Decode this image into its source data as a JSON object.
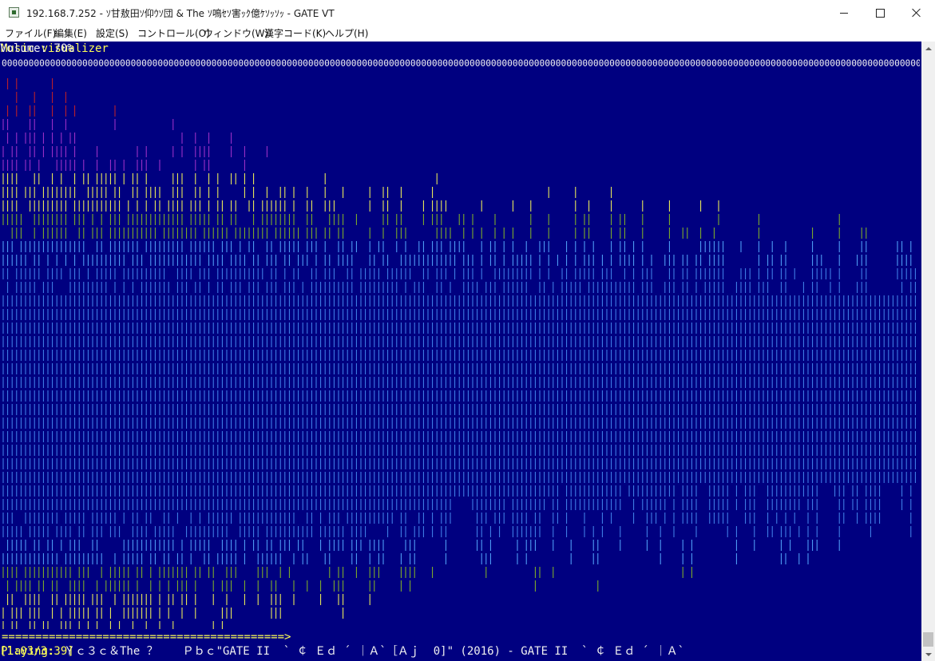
{
  "window": {
    "title": "192.168.7.252 - ｿ甘敖田ｿ仰ｳｿ団 & The ｿ鳴ｾｿ害ｯｸ億ｹｿｯｿｯ - GATE VT",
    "app_icon": "terminal-app-icon",
    "minimize_icon": "minimize-icon",
    "maximize_icon": "maximize-icon",
    "close_icon": "close-icon"
  },
  "menu": {
    "items": [
      {
        "label": "ファイル(F)"
      },
      {
        "label": "編集(E)"
      },
      {
        "label": "設定(S)"
      },
      {
        "label": "コントロール(O)"
      },
      {
        "label": "ウィンドウ(W)"
      },
      {
        "label": "漢字コード(K)"
      },
      {
        "label": "ヘルプ(H)"
      }
    ]
  },
  "terminal": {
    "title": "Music visualizer",
    "volume": "Volume: 70%",
    "zeros": "00000000000000000000000000000000000000000000000000000000000000000000000000000000000000000000000000000000000000000000000000000000000000000000000000000000000000000000000000000000000000000000000000000000000000",
    "progress": "==========================================>",
    "playing_label": "Playing:",
    "playing_title": "Ｙｃ３ｃ＆The ？￣  Ｐｂｃ\"GATE II  ` ￠ Ｅｄ ´ ｜Ａ`［Ａｊ  0]\" (2016) - GATE II  ` ￠ Ｅｄ ´ ｜Ａ`",
    "time": "[1:03/3:39]",
    "colors": {
      "background": "#000080",
      "red": "#cc2222",
      "magenta": "#aa33cc",
      "yellow": "#ffff55",
      "green": "#88bb22",
      "lightblue": "#55aaff",
      "blue": "#4488ee"
    }
  },
  "scrollbar": {
    "up_icon": "scroll-up-arrow-icon",
    "down_icon": "scroll-down-arrow-icon"
  }
}
